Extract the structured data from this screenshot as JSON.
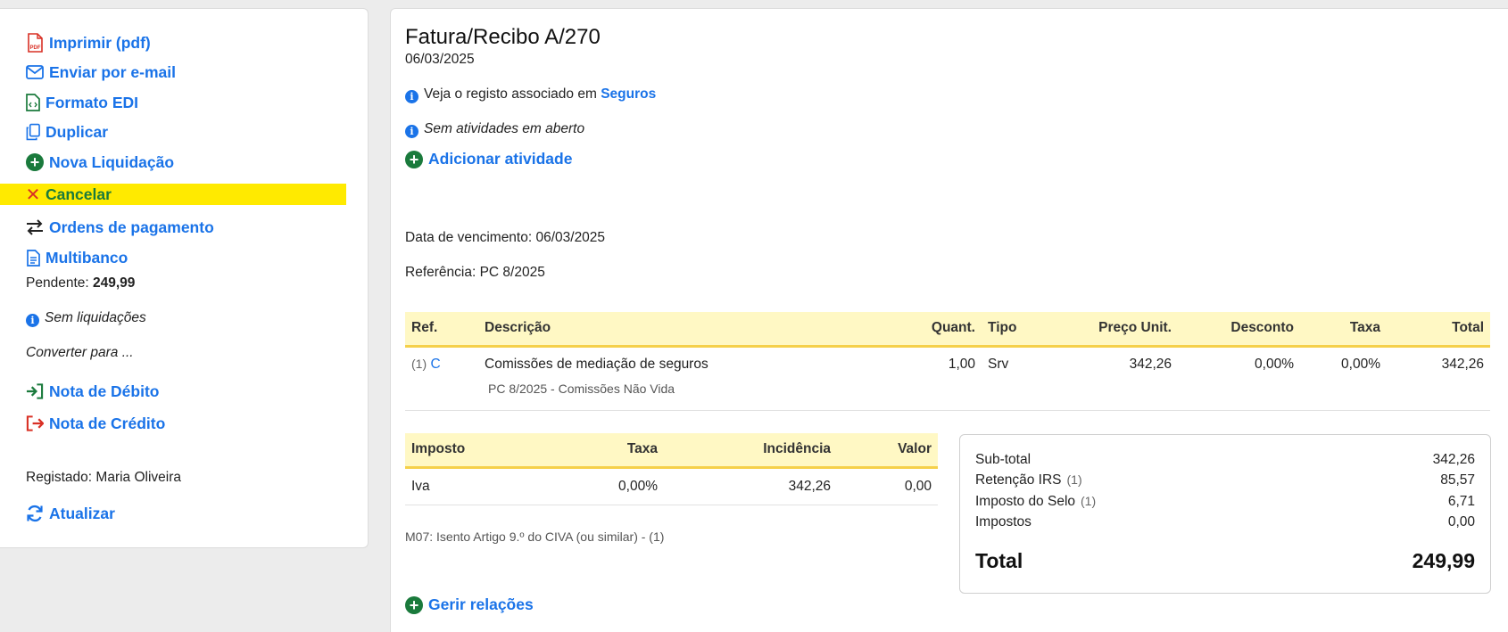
{
  "sidebar": {
    "actions": {
      "print": "Imprimir (pdf)",
      "email": "Enviar por e-mail",
      "edi": "Formato EDI",
      "duplicate": "Duplicar",
      "new_settlement": "Nova Liquidação",
      "cancel": "Cancelar",
      "payment_orders": "Ordens de pagamento",
      "multibanco": "Multibanco"
    },
    "pending_label": "Pendente:",
    "pending_value": "249,99",
    "no_settlements": "Sem liquidações",
    "convert_to": "Converter para ...",
    "debit_note": "Nota de Débito",
    "credit_note": "Nota de Crédito",
    "registered": "Registado: Maria Oliveira",
    "refresh": "Atualizar",
    "highlight_color": "#ffea00"
  },
  "document": {
    "title": "Fatura/Recibo A/270",
    "date": "06/03/2025",
    "associated_text": "Veja o registo associado em",
    "associated_link": "Seguros",
    "no_activities": "Sem atividades em aberto",
    "add_activity": "Adicionar atividade",
    "due_date": "Data de vencimento: 06/03/2025",
    "reference": "Referência: PC 8/2025",
    "manage_relations": "Gerir relações"
  },
  "items_table": {
    "headers": {
      "ref": "Ref.",
      "description": "Descrição",
      "qty": "Quant.",
      "type": "Tipo",
      "unit_price": "Preço Unit.",
      "discount": "Desconto",
      "rate": "Taxa",
      "total": "Total"
    },
    "rows": [
      {
        "num": "(1)",
        "ref": "C",
        "description": "Comissões de mediação de seguros",
        "sub": "PC 8/2025 - Comissões Não Vida",
        "qty": "1,00",
        "type": "Srv",
        "unit_price": "342,26",
        "discount": "0,00%",
        "rate": "0,00%",
        "total": "342,26"
      }
    ]
  },
  "tax_table": {
    "headers": {
      "tax": "Imposto",
      "rate": "Taxa",
      "base": "Incidência",
      "value": "Valor"
    },
    "rows": [
      {
        "tax": "Iva",
        "rate": "0,00%",
        "base": "342,26",
        "value": "0,00"
      }
    ],
    "note": "M07: Isento Artigo 9.º do CIVA (ou similar) - (1)"
  },
  "totals": {
    "subtotal_label": "Sub-total",
    "subtotal": "342,26",
    "irs_label": "Retenção IRS",
    "irs_ref": "(1)",
    "irs": "85,57",
    "stamp_label": "Imposto do Selo",
    "stamp_ref": "(1)",
    "stamp": "6,71",
    "taxes_label": "Impostos",
    "taxes": "0,00",
    "total_label": "Total",
    "total": "249,99"
  }
}
